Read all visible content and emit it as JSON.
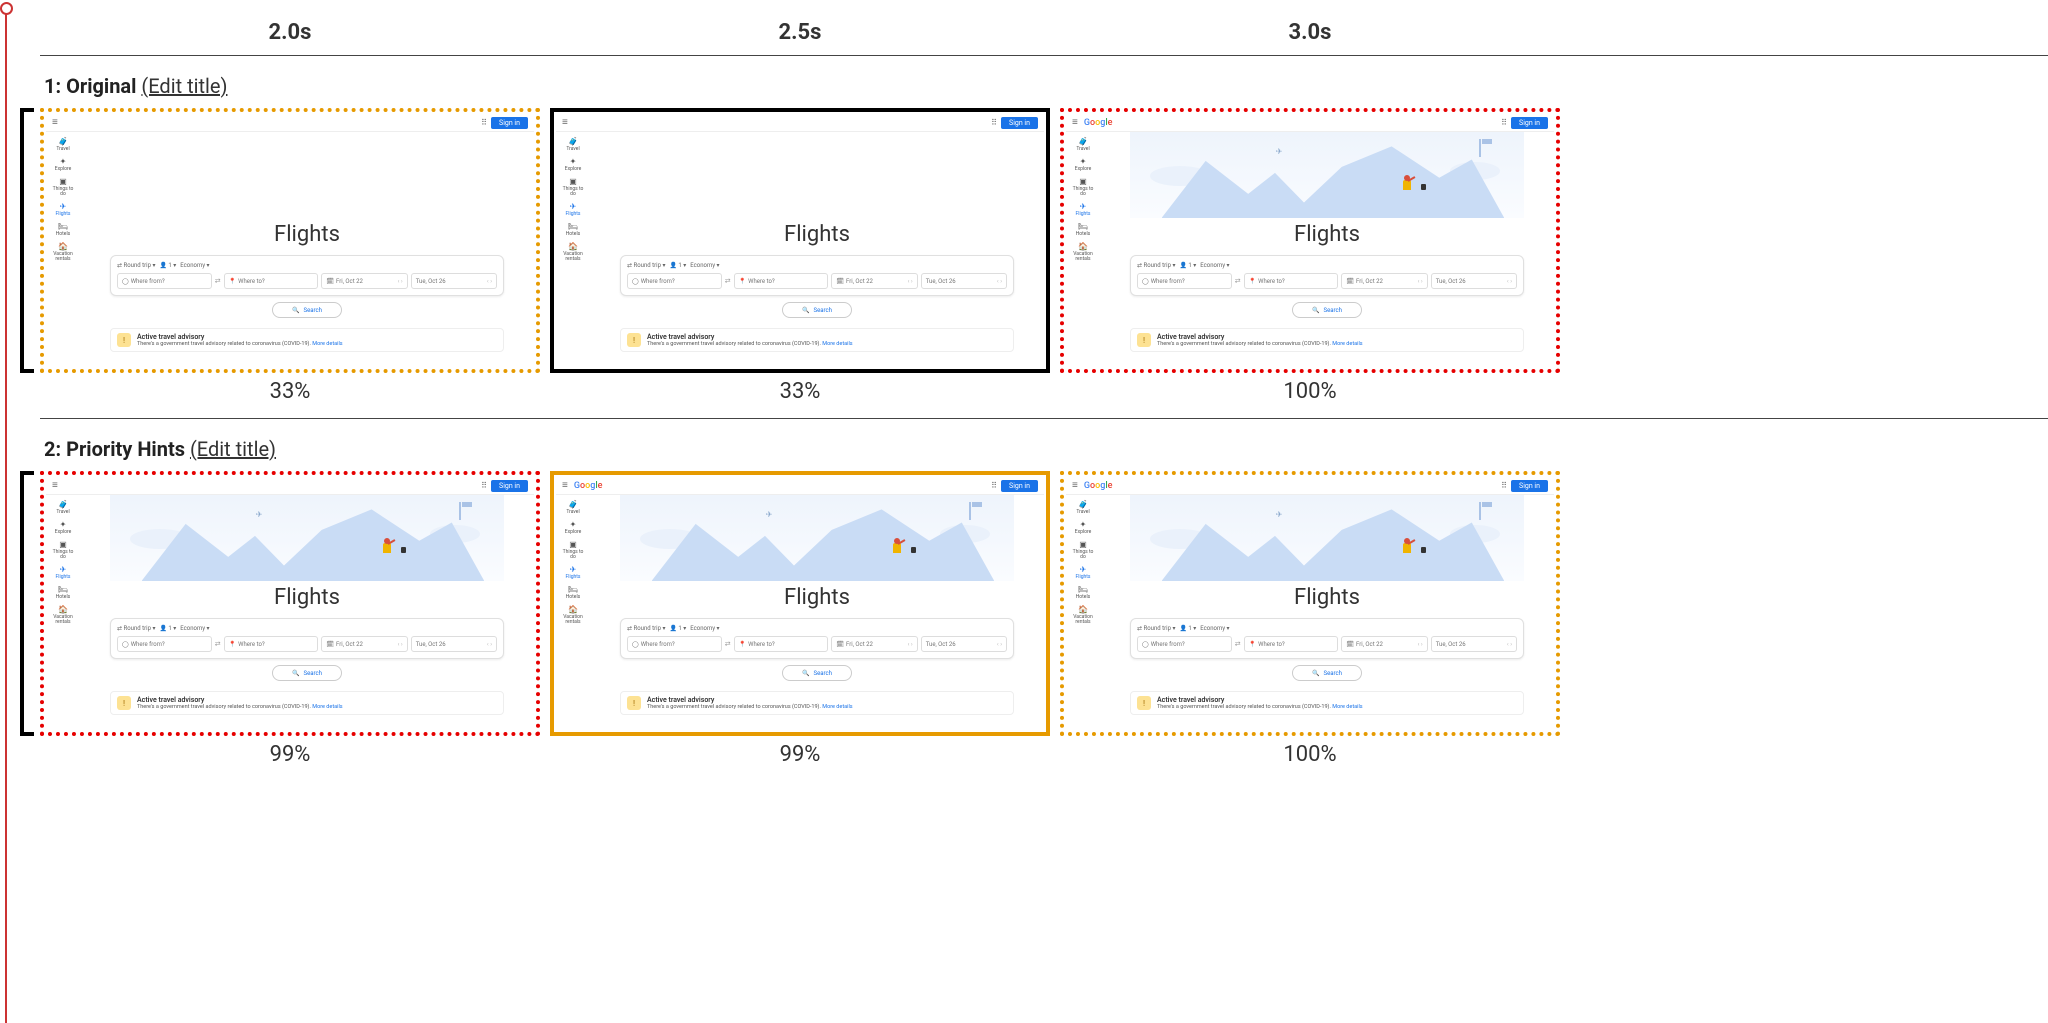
{
  "timestamps": {
    "t1": "2.0s",
    "t2": "2.5s",
    "t3": "3.0s"
  },
  "rows": [
    {
      "index": "1",
      "title": "Original",
      "edit": "(Edit title)",
      "frames": [
        {
          "percent": "33%",
          "border": "dotted-orange",
          "hero": "blank",
          "logo": false
        },
        {
          "percent": "33%",
          "border": "solid-black",
          "hero": "blank",
          "logo": false
        },
        {
          "percent": "100%",
          "border": "dotted-red",
          "hero": "img",
          "logo": true
        }
      ]
    },
    {
      "index": "2",
      "title": "Priority Hints",
      "edit": "(Edit title)",
      "frames": [
        {
          "percent": "99%",
          "border": "dotted-red",
          "hero": "img",
          "logo": false
        },
        {
          "percent": "99%",
          "border": "solid-orange",
          "hero": "img",
          "logo": true
        },
        {
          "percent": "100%",
          "border": "dotted-orange",
          "hero": "img",
          "logo": true
        }
      ]
    }
  ],
  "gf": {
    "signin": "Sign in",
    "heading": "Flights",
    "sidebar": [
      {
        "icon": "🧳",
        "label": "Travel"
      },
      {
        "icon": "✦",
        "label": "Explore"
      },
      {
        "icon": "▣",
        "label": "Things to do"
      },
      {
        "icon": "✈",
        "label": "Flights"
      },
      {
        "icon": "🛏",
        "label": "Hotels"
      },
      {
        "icon": "🏠",
        "label": "Vacation rentals"
      }
    ],
    "selectors": {
      "trip": "Round trip ▾",
      "pax": "1 ▾",
      "class": "Economy ▾"
    },
    "from_placeholder": "Where from?",
    "to_placeholder": "Where to?",
    "date1": "Fri, Oct 22",
    "date2": "Tue, Oct 26",
    "search": "Search",
    "advisory_title": "Active travel advisory",
    "advisory_sub": "There's a government travel advisory related to coronavirus (COVID-19). ",
    "advisory_link": "More details",
    "logo": {
      "g1": "G",
      "g2": "o",
      "g3": "o",
      "g4": "g",
      "g5": "l",
      "g6": "e"
    }
  }
}
